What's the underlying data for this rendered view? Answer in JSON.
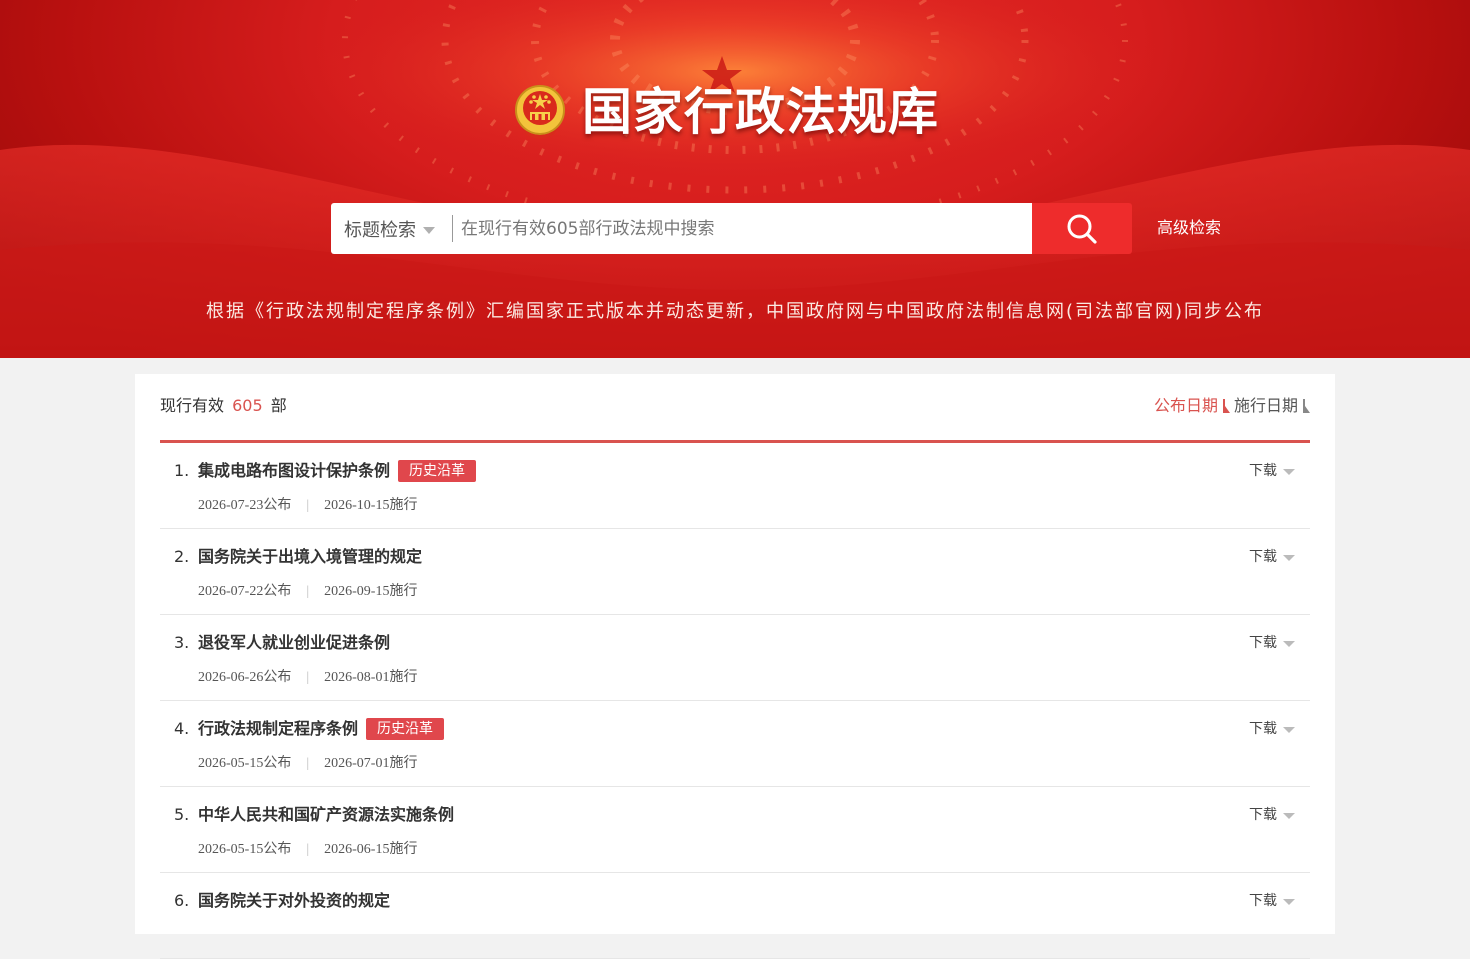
{
  "header": {
    "site_title": "国家行政法规库",
    "search": {
      "type_label": "标题检索",
      "placeholder": "在现行有效605部行政法规中搜索",
      "value": ""
    },
    "advanced_label": "高级检索",
    "tagline": "根据《行政法规制定程序条例》汇编国家正式版本并动态更新，中国政府网与中国政府法制信息网(司法部官网)同步公布"
  },
  "summary": {
    "prefix": "现行有效",
    "count": "605",
    "suffix": "部"
  },
  "sort": {
    "options": [
      {
        "label": "公布日期",
        "active": true
      },
      {
        "label": "施行日期",
        "active": false
      }
    ]
  },
  "laws": [
    {
      "index": "1.",
      "title": "集成电路布图设计保护条例",
      "badge": "历史沿革",
      "published": "2026-07-23公布",
      "effective": "2026-10-15施行",
      "download": "下载"
    },
    {
      "index": "2.",
      "title": "国务院关于出境入境管理的规定",
      "badge": "",
      "published": "2026-07-22公布",
      "effective": "2026-09-15施行",
      "download": "下载"
    },
    {
      "index": "3.",
      "title": "退役军人就业创业促进条例",
      "badge": "",
      "published": "2026-06-26公布",
      "effective": "2026-08-01施行",
      "download": "下载"
    },
    {
      "index": "4.",
      "title": "行政法规制定程序条例",
      "badge": "历史沿革",
      "published": "2026-05-15公布",
      "effective": "2026-07-01施行",
      "download": "下载"
    },
    {
      "index": "5.",
      "title": "中华人民共和国矿产资源法实施条例",
      "badge": "",
      "published": "2026-05-15公布",
      "effective": "2026-06-15施行",
      "download": "下载"
    },
    {
      "index": "6.",
      "title": "国务院关于对外投资的规定",
      "badge": "",
      "published": "",
      "effective": "",
      "download": "下载"
    }
  ],
  "colors": {
    "accent": "#d9534f",
    "banner": "#d61d1d",
    "search_button": "#ee2c2c",
    "badge": "#e0474c"
  },
  "icons": {
    "emblem": "national-emblem-icon",
    "search": "search-icon",
    "dropdown": "chevron-down-icon",
    "sort": "sort-icon"
  }
}
